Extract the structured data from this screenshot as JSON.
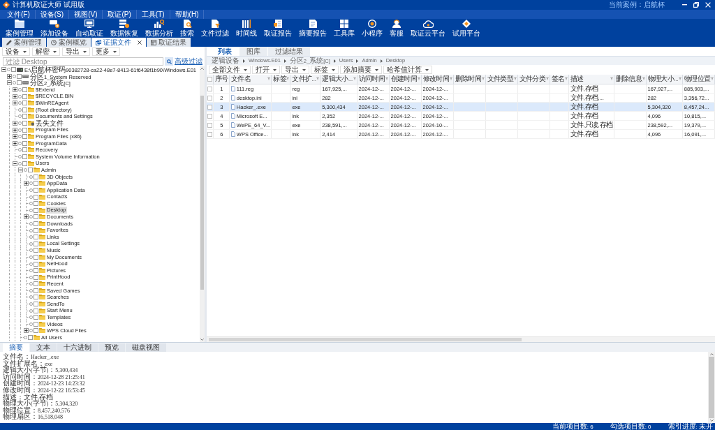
{
  "window": {
    "title": "计算机取证大师 试用版",
    "current_case": "当前案例：启航杯"
  },
  "menu": [
    "文件(F)",
    "设备(S)",
    "视图(V)",
    "取证(P)",
    "工具(T)",
    "帮助(H)"
  ],
  "toolbar": [
    {
      "label": "案例管理",
      "kind": "folder"
    },
    {
      "label": "添加设备",
      "kind": "adddrive"
    },
    {
      "label": "自动取证",
      "kind": "monitor"
    },
    {
      "label": "数据恢复",
      "kind": "recovery"
    },
    {
      "label": "数据分析",
      "kind": "analysis"
    },
    {
      "label": "搜索",
      "kind": "search"
    },
    {
      "label": "文件过滤",
      "kind": "filter"
    },
    {
      "label": "时间线",
      "kind": "timeline"
    },
    {
      "label": "取证报告",
      "kind": "report"
    },
    {
      "label": "摘要报告",
      "kind": "summary"
    },
    {
      "label": "工具库",
      "kind": "tools"
    },
    {
      "label": "小程序",
      "kind": "applet"
    },
    {
      "label": "客服",
      "kind": "support"
    },
    {
      "label": "取证云平台",
      "kind": "cloud"
    },
    {
      "label": "试用平台",
      "kind": "trial"
    }
  ],
  "tabs": [
    {
      "label": "案例管理",
      "kind": "case",
      "selected": false,
      "closable": false
    },
    {
      "label": "案例概览",
      "kind": "overview",
      "selected": false,
      "closable": false
    },
    {
      "label": "证据文件",
      "kind": "evidence",
      "selected": true,
      "closable": true
    },
    {
      "label": "取证结果",
      "kind": "result",
      "selected": false,
      "closable": false
    }
  ],
  "left_panel": {
    "toolbar": [
      "设备",
      "解密",
      "导出",
      "更多"
    ],
    "filter": {
      "placeholder": "过滤 Desktop",
      "link": "高级过滤"
    },
    "tree": [
      {
        "label": "E:\\启航杯密码90382728-ca22-48e7-8413-61f6438f1b90\\Windows.E01",
        "kind": "image",
        "expanded": true,
        "checked": false,
        "selected": false,
        "children": [
          {
            "label": "分区1_System Reserved",
            "kind": "partition",
            "expanded": false,
            "checked": false,
            "selected": false
          },
          {
            "label": "分区2_系统[C]",
            "kind": "partition",
            "expanded": true,
            "checked": false,
            "selected": false,
            "children": [
              {
                "label": "$Extend",
                "kind": "folder",
                "expanded": false,
                "checked": false,
                "selected": false
              },
              {
                "label": "$RECYCLE.BIN",
                "kind": "folder",
                "expanded": false,
                "checked": false,
                "selected": false
              },
              {
                "label": "$WinREAgent",
                "kind": "folder",
                "expanded": false,
                "checked": false,
                "selected": false
              },
              {
                "label": "(Root directory)",
                "kind": "folder",
                "checked": false,
                "selected": false
              },
              {
                "label": "Documents and Settings",
                "kind": "folder",
                "checked": false,
                "selected": false
              },
              {
                "label": "丢失文件",
                "kind": "lost",
                "expanded": false,
                "checked": false,
                "selected": false
              },
              {
                "label": "Program Files",
                "kind": "folder",
                "expanded": false,
                "checked": false,
                "selected": false
              },
              {
                "label": "Program Files (x86)",
                "kind": "folder",
                "expanded": false,
                "checked": false,
                "selected": false
              },
              {
                "label": "ProgramData",
                "kind": "folder",
                "expanded": false,
                "checked": false,
                "selected": false
              },
              {
                "label": "Recovery",
                "kind": "folder",
                "checked": false,
                "selected": false
              },
              {
                "label": "System Volume Information",
                "kind": "folder",
                "checked": false,
                "selected": false
              },
              {
                "label": "Users",
                "kind": "folder",
                "expanded": true,
                "checked": false,
                "selected": false,
                "children": [
                  {
                    "label": "Admin",
                    "kind": "folder",
                    "expanded": true,
                    "checked": false,
                    "selected": false,
                    "children": [
                      {
                        "label": "3D Objects",
                        "kind": "folder",
                        "checked": false,
                        "selected": false
                      },
                      {
                        "label": "AppData",
                        "kind": "folder",
                        "expanded": false,
                        "checked": false,
                        "selected": false
                      },
                      {
                        "label": "Application Data",
                        "kind": "folder",
                        "checked": false,
                        "selected": false
                      },
                      {
                        "label": "Contacts",
                        "kind": "folder",
                        "checked": false,
                        "selected": false
                      },
                      {
                        "label": "Cookies",
                        "kind": "folder",
                        "checked": false,
                        "selected": false
                      },
                      {
                        "label": "Desktop",
                        "kind": "folder",
                        "checked": false,
                        "selected": true
                      },
                      {
                        "label": "Documents",
                        "kind": "folder",
                        "expanded": false,
                        "checked": false,
                        "selected": false
                      },
                      {
                        "label": "Downloads",
                        "kind": "folder",
                        "checked": false,
                        "selected": false
                      },
                      {
                        "label": "Favorites",
                        "kind": "folder",
                        "checked": false,
                        "selected": false
                      },
                      {
                        "label": "Links",
                        "kind": "folder",
                        "checked": false,
                        "selected": false
                      },
                      {
                        "label": "Local Settings",
                        "kind": "folder",
                        "checked": false,
                        "selected": false
                      },
                      {
                        "label": "Music",
                        "kind": "folder",
                        "checked": false,
                        "selected": false
                      },
                      {
                        "label": "My Documents",
                        "kind": "folder",
                        "checked": false,
                        "selected": false
                      },
                      {
                        "label": "NetHood",
                        "kind": "folder",
                        "checked": false,
                        "selected": false
                      },
                      {
                        "label": "Pictures",
                        "kind": "folder",
                        "checked": false,
                        "selected": false
                      },
                      {
                        "label": "PrintHood",
                        "kind": "folder",
                        "checked": false,
                        "selected": false
                      },
                      {
                        "label": "Recent",
                        "kind": "folder",
                        "checked": false,
                        "selected": false
                      },
                      {
                        "label": "Saved Games",
                        "kind": "folder",
                        "checked": false,
                        "selected": false
                      },
                      {
                        "label": "Searches",
                        "kind": "folder",
                        "checked": false,
                        "selected": false
                      },
                      {
                        "label": "SendTo",
                        "kind": "folder",
                        "checked": false,
                        "selected": false
                      },
                      {
                        "label": "Start Menu",
                        "kind": "folder",
                        "checked": false,
                        "selected": false
                      },
                      {
                        "label": "Templates",
                        "kind": "folder",
                        "checked": false,
                        "selected": false
                      },
                      {
                        "label": "Videos",
                        "kind": "folder",
                        "checked": false,
                        "selected": false
                      },
                      {
                        "label": "WPS Cloud Files",
                        "kind": "folder",
                        "expanded": false,
                        "checked": false,
                        "selected": false
                      }
                    ]
                  },
                  {
                    "label": "All Users",
                    "kind": "folder",
                    "checked": false,
                    "selected": false
                  }
                ]
              }
            ]
          }
        ]
      }
    ]
  },
  "right_panel": {
    "tabs": [
      {
        "label": "列表",
        "selected": true
      },
      {
        "label": "图库",
        "selected": false
      },
      {
        "label": "过滤结果",
        "selected": false
      }
    ],
    "breadcrumb": [
      "逻辑设备",
      "Windows.E01",
      "分区2_系统[C]",
      "Users",
      "Admin",
      "Desktop"
    ],
    "toolbar": [
      "全部文件",
      "打开",
      "导出",
      "标签",
      "添加摘要",
      "哈希值计算"
    ],
    "table": {
      "select_all_checked": false,
      "columns": [
        {
          "label": "序号",
          "kind": "number"
        },
        {
          "label": "文件名",
          "kind": "file"
        },
        {
          "label": "标签",
          "kind": "text"
        },
        {
          "label": "文件扩...",
          "kind": "text"
        },
        {
          "label": "逻辑大小...",
          "kind": "text"
        },
        {
          "label": "访问时间",
          "kind": "text"
        },
        {
          "label": "创建时间",
          "kind": "text"
        },
        {
          "label": "修改时间",
          "kind": "text"
        },
        {
          "label": "删除时间",
          "kind": "text"
        },
        {
          "label": "文件类型",
          "kind": "text"
        },
        {
          "label": "文件分类",
          "kind": "text"
        },
        {
          "label": "签名",
          "kind": "text"
        },
        {
          "label": "描述",
          "kind": "text"
        },
        {
          "label": "删除信息",
          "kind": "text"
        },
        {
          "label": "物理大小...",
          "kind": "text"
        },
        {
          "label": "物理位置",
          "kind": "text"
        }
      ],
      "rows": [
        {
          "selected": false,
          "checked": false,
          "cells": [
            "1",
            "111.reg",
            null,
            "reg",
            "167,925,...",
            "2024-12-...",
            "2024-12-...",
            "2024-12-...",
            null,
            null,
            null,
            null,
            "文件,存档",
            null,
            "167,927,...",
            "885,903,..."
          ]
        },
        {
          "selected": false,
          "checked": false,
          "cells": [
            "2",
            "desktop.ini",
            null,
            "ini",
            "282",
            "2024-12-...",
            "2024-12-...",
            "2024-12-...",
            null,
            null,
            null,
            null,
            "文件,存档,...",
            null,
            "282",
            "3,356,72..."
          ]
        },
        {
          "selected": true,
          "checked": false,
          "cells": [
            "3",
            "Hacker_.exe",
            null,
            "exe",
            "5,300,434",
            "2024-12-...",
            "2024-12-...",
            "2024-12-...",
            null,
            null,
            null,
            null,
            "文件,存档",
            null,
            "5,304,320",
            "8,457,24..."
          ]
        },
        {
          "selected": false,
          "checked": false,
          "cells": [
            "4",
            "Microsoft E...",
            null,
            "lnk",
            "2,352",
            "2024-12-...",
            "2024-12-...",
            "2024-12-...",
            null,
            null,
            null,
            null,
            "文件,存档",
            null,
            "4,096",
            "10,815,..."
          ]
        },
        {
          "selected": false,
          "checked": false,
          "cells": [
            "5",
            "WePE_64_V...",
            null,
            "exe",
            "238,591,...",
            "2024-12-...",
            "2024-12-...",
            "2024-10-...",
            null,
            null,
            null,
            null,
            "文件,只读,存档",
            null,
            "238,592,...",
            "19,379,..."
          ]
        },
        {
          "selected": false,
          "checked": false,
          "cells": [
            "6",
            "WPS Office...",
            null,
            "lnk",
            "2,414",
            "2024-12-...",
            "2024-12-...",
            "2024-12-...",
            null,
            null,
            null,
            null,
            "文件,存档",
            null,
            "4,096",
            "16,091,..."
          ]
        }
      ]
    }
  },
  "bottom_panel": {
    "tabs": [
      {
        "label": "摘要",
        "selected": true
      },
      {
        "label": "文本",
        "selected": false
      },
      {
        "label": "十六进制",
        "selected": false
      },
      {
        "label": "预览",
        "selected": false
      },
      {
        "label": "磁盘视图",
        "selected": false
      }
    ],
    "summary": [
      "文件名：Hacker_.exe",
      "文件扩展名：exe",
      "逻辑大小(字节)：5,300,434",
      "访问时间：2024-12-28 21:25:41",
      "创建时间：2024-12-23 14:23:32",
      "修改时间：2024-12-22 16:53:45",
      "描述：文件,存档",
      "物理大小(字节)：5,304,320",
      "物理位置：8,457,240,576",
      "物理扇区：16,518,048"
    ]
  },
  "status_bar": [
    "当前项目数: 6",
    "勾选项目数: 0",
    "索引进度: 未开"
  ]
}
